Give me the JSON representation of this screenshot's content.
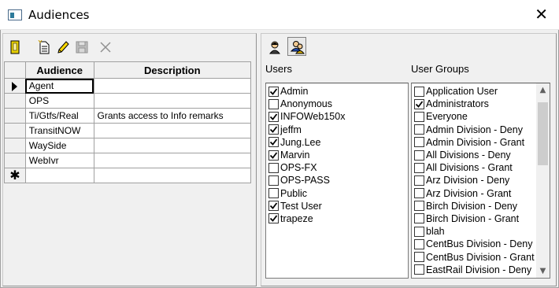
{
  "window": {
    "title": "Audiences",
    "close_glyph": "✕"
  },
  "toolbar": [
    {
      "name": "open-book-icon",
      "color": "#d4c000"
    },
    {
      "name": "new-document-icon"
    },
    {
      "name": "edit-pencil-icon"
    },
    {
      "name": "save-disk-icon",
      "disabled": true
    },
    {
      "name": "delete-x-icon",
      "disabled": true
    }
  ],
  "right_toolbar": [
    {
      "name": "user-view-icon"
    },
    {
      "name": "group-view-icon"
    }
  ],
  "grid": {
    "columns": [
      "Audience",
      "Description"
    ],
    "rows": [
      {
        "audience": "Agent",
        "description": "",
        "current": true
      },
      {
        "audience": "OPS",
        "description": ""
      },
      {
        "audience": "Ti/Gtfs/Real",
        "description": "Grants access to Info remarks"
      },
      {
        "audience": "TransitNOW",
        "description": ""
      },
      {
        "audience": "WaySide",
        "description": ""
      },
      {
        "audience": "WebIvr",
        "description": ""
      }
    ],
    "new_row_glyph": "✱"
  },
  "users": {
    "label": "Users",
    "items": [
      {
        "label": "Admin",
        "checked": true
      },
      {
        "label": "Anonymous",
        "checked": false
      },
      {
        "label": "INFOWeb150x",
        "checked": true
      },
      {
        "label": "jeffm",
        "checked": true
      },
      {
        "label": "Jung.Lee",
        "checked": true
      },
      {
        "label": "Marvin",
        "checked": true
      },
      {
        "label": "OPS-FX",
        "checked": false
      },
      {
        "label": "OPS-PASS",
        "checked": false
      },
      {
        "label": "Public",
        "checked": false
      },
      {
        "label": "Test User",
        "checked": true
      },
      {
        "label": "trapeze",
        "checked": true
      }
    ]
  },
  "user_groups": {
    "label": "User Groups",
    "items": [
      {
        "label": "Application User",
        "checked": false
      },
      {
        "label": "Administrators",
        "checked": true
      },
      {
        "label": "Everyone",
        "checked": false
      },
      {
        "label": "Admin Division - Deny",
        "checked": false
      },
      {
        "label": "Admin Division - Grant",
        "checked": false
      },
      {
        "label": "All Divisions - Deny",
        "checked": false
      },
      {
        "label": "All Divisions - Grant",
        "checked": false
      },
      {
        "label": "Arz Division - Deny",
        "checked": false
      },
      {
        "label": "Arz Division - Grant",
        "checked": false
      },
      {
        "label": "Birch Division - Deny",
        "checked": false
      },
      {
        "label": "Birch Division - Grant",
        "checked": false
      },
      {
        "label": "blah",
        "checked": false
      },
      {
        "label": "CentBus Division - Deny",
        "checked": false
      },
      {
        "label": "CentBus Division - Grant",
        "checked": false
      },
      {
        "label": "EastRail Division - Deny",
        "checked": false
      }
    ],
    "scroll_up_glyph": "▲",
    "scroll_down_glyph": "▼"
  }
}
